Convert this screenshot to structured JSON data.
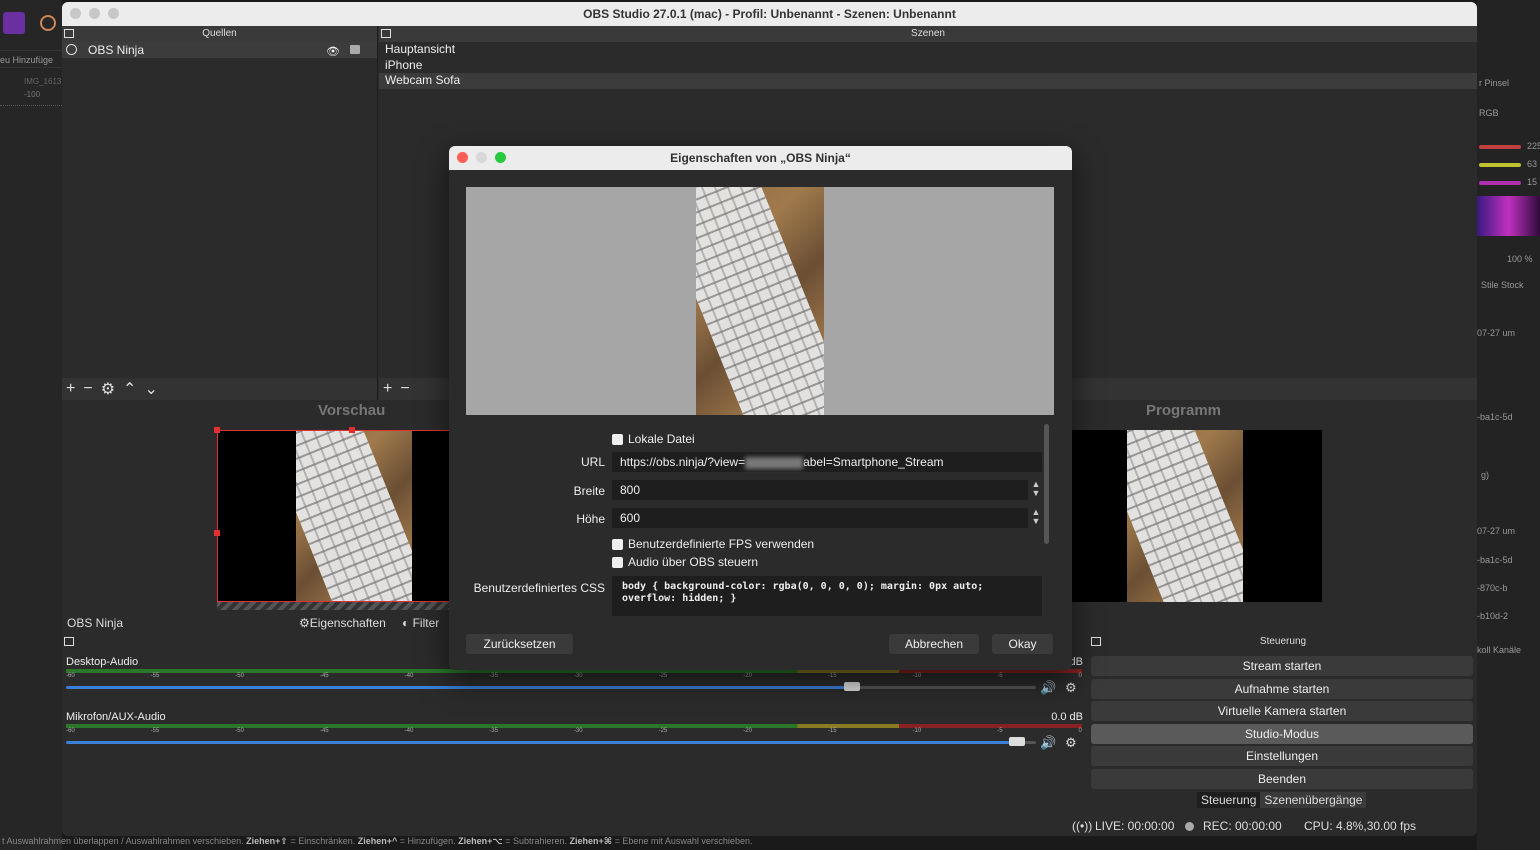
{
  "window": {
    "title": "OBS Studio 27.0.1 (mac) - Profil: Unbenannt - Szenen: Unbenannt"
  },
  "sources": {
    "header": "Quellen",
    "items": [
      {
        "label": "OBS Ninja"
      }
    ]
  },
  "scenes": {
    "header": "Szenen",
    "items": [
      {
        "label": "Hauptansicht"
      },
      {
        "label": "iPhone"
      },
      {
        "label": "Webcam Sofa"
      }
    ]
  },
  "preview": {
    "label": "Vorschau"
  },
  "program": {
    "label": "Programm"
  },
  "source_toolbar": {
    "selected_source": "OBS Ninja",
    "properties_label": "Eigenschaften",
    "filter_label": "Filter"
  },
  "mixer": {
    "tracks": [
      {
        "name": "Desktop-Audio",
        "db": "dB",
        "volume": 0.81
      },
      {
        "name": "Mikrofon/AUX-Audio",
        "db": "0.0 dB",
        "volume": 0.98
      }
    ],
    "ticks": [
      "-60",
      "-55",
      "-50",
      "-45",
      "-40",
      "-35",
      "-30",
      "-25",
      "-20",
      "-15",
      "-10",
      "-5",
      "0"
    ]
  },
  "controls": {
    "header": "Steuerung",
    "buttons": [
      "Stream starten",
      "Aufnahme starten",
      "Virtuelle Kamera starten",
      "Studio-Modus",
      "Einstellungen",
      "Beenden"
    ],
    "tabs": [
      "Steuerung",
      "Szenenübergänge"
    ]
  },
  "status": {
    "live": "LIVE: 00:00:00",
    "rec": "REC: 00:00:00",
    "cpu": "CPU: 4.8%,30.00 fps"
  },
  "dialog": {
    "title": "Eigenschaften von „OBS Ninja“",
    "local_file_label": "Lokale Datei",
    "url_label": "URL",
    "url_prefix": "https://obs.ninja/?view=",
    "url_suffix": "abel=Smartphone_Stream",
    "width_label": "Breite",
    "width_value": "800",
    "height_label": "Höhe",
    "height_value": "600",
    "custom_fps_label": "Benutzerdefinierte FPS verwenden",
    "audio_obs_label": "Audio über OBS steuern",
    "css_label": "Benutzerdefiniertes CSS",
    "css_line1": "body { background-color: rgba(0, 0, 0, 0); margin: 0px auto;",
    "css_line2": "overflow: hidden; }",
    "reset_label": "Zurücksetzen",
    "cancel_label": "Abbrechen",
    "ok_label": "Okay"
  },
  "background_app": {
    "left_tabs": "eu  Hinzufüge",
    "left_file": "IMG_1613",
    "left_ruler": "-100",
    "right_labels": [
      "r   Pinsel",
      "RGB",
      "225",
      "63",
      "15",
      "100 %",
      "Stile  Stock",
      "07-27 um",
      "-ba1c-5d",
      "g)",
      "07-27 um",
      "-ba1c-5d",
      "-870c-b",
      "-b10d-2",
      "koll  Kanäle"
    ]
  },
  "statusline": {
    "part1": "t Auswahlrahmen überlappen / Auswahlrahmen verschieben. ",
    "key1": "Ziehen+⇧",
    "part2": " = Einschränken. ",
    "key2": "Ziehen+^",
    "part3": " = Hinzufügen. ",
    "key3": "Ziehen+⌥",
    "part4": " = Subtrahieren. ",
    "key4": "Ziehen+⌘",
    "part5": " = Ebene mit Auswahl verschieben."
  }
}
